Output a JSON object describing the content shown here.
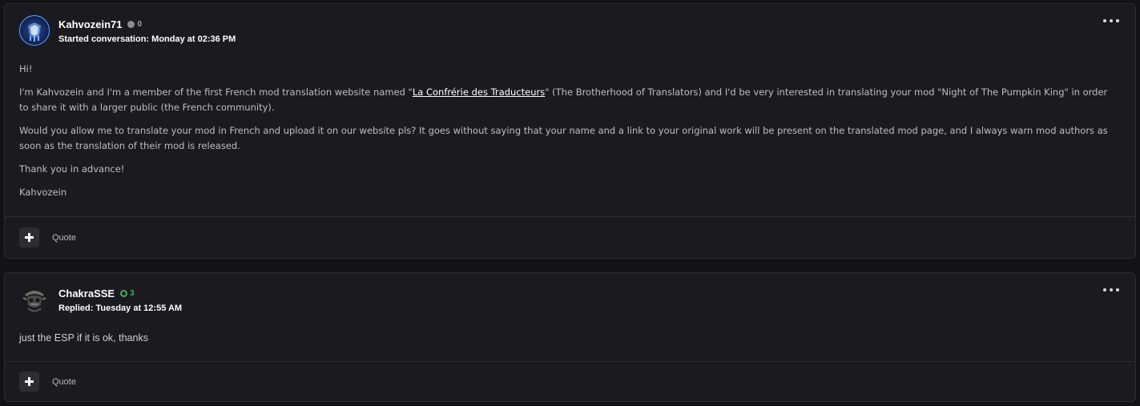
{
  "messages": [
    {
      "author": "Kahvozein71",
      "reputation": "0",
      "reputation_state": "neutral",
      "action": "Started conversation:",
      "timestamp": "Monday at 02:36 PM",
      "body": {
        "p1": "Hi!",
        "p2_before": "I'm Kahvozein and I'm a member of the first French mod translation website named \"",
        "p2_link": "La Confrérie des Traducteurs",
        "p2_after": "\" (The Brotherhood of Translators) and I'd be very interested in translating your mod \"Night of The Pumpkin King\" in order to share it with a larger public (the French community).",
        "p3": "Would you allow me to translate your mod in French and upload it on our website pls? It goes without saying that your name and a link to your original work will be present on the translated mod page, and I always warn mod authors as soon as the translation of their mod is released.",
        "p4": "Thank you in advance!",
        "p5": "Kahvozein"
      },
      "quote_label": "Quote"
    },
    {
      "author": "ChakraSSE",
      "reputation": "3",
      "reputation_state": "positive",
      "action": "Replied:",
      "timestamp": "Tuesday at 12:55 AM",
      "body": {
        "p1": "just the ESP if it is ok, thanks"
      },
      "quote_label": "Quote"
    }
  ],
  "icons": {
    "menu": "more-horizontal-icon",
    "add": "plus-icon"
  },
  "colors": {
    "background": "#131316",
    "card": "#1b1b1f",
    "positive_rep": "#3fae5a",
    "neutral_rep": "#8d8d93"
  }
}
